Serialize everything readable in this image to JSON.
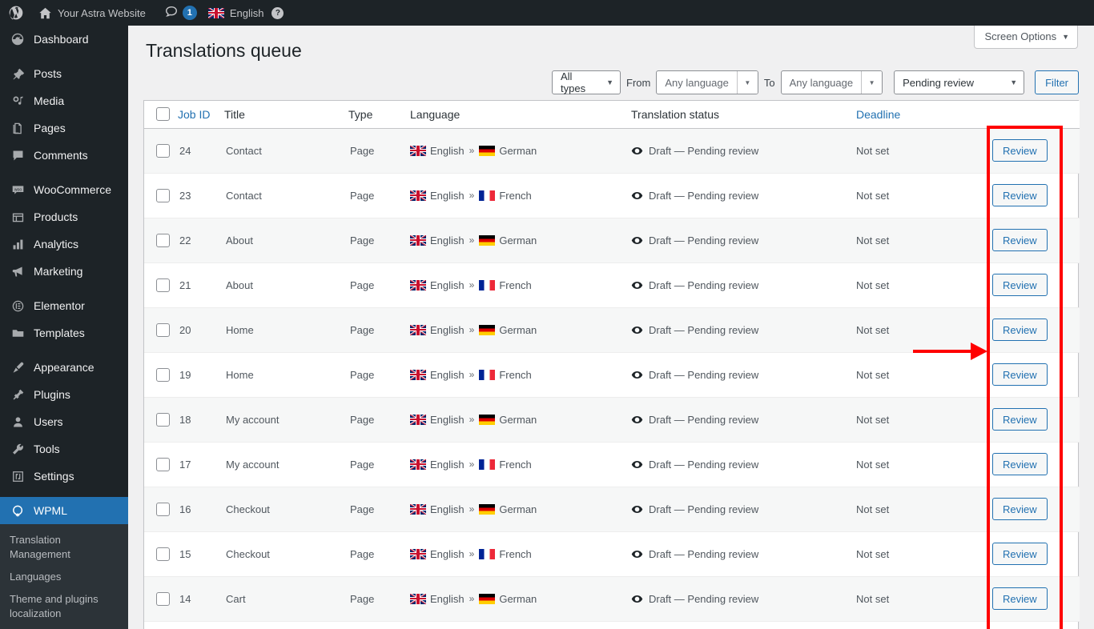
{
  "adminbar": {
    "wp_logo": "wordpress-logo-icon",
    "home_icon": "home-icon",
    "site_name": "Your Astra Website",
    "comment_icon": "comment-bubble-icon",
    "comment_count": "1",
    "flag_icon": "uk-flag-icon",
    "language": "English",
    "help_icon": "?"
  },
  "sidebar": {
    "items": [
      {
        "label": "Dashboard",
        "icon": "dashboard-icon"
      },
      {
        "label": "Posts",
        "icon": "pin-icon"
      },
      {
        "label": "Media",
        "icon": "media-icon"
      },
      {
        "label": "Pages",
        "icon": "pages-icon"
      },
      {
        "label": "Comments",
        "icon": "comments-icon"
      },
      {
        "label": "WooCommerce",
        "icon": "woocommerce-icon"
      },
      {
        "label": "Products",
        "icon": "products-icon"
      },
      {
        "label": "Analytics",
        "icon": "analytics-icon"
      },
      {
        "label": "Marketing",
        "icon": "megaphone-icon"
      },
      {
        "label": "Elementor",
        "icon": "elementor-icon"
      },
      {
        "label": "Templates",
        "icon": "folder-icon"
      },
      {
        "label": "Appearance",
        "icon": "paintbrush-icon"
      },
      {
        "label": "Plugins",
        "icon": "plug-icon"
      },
      {
        "label": "Users",
        "icon": "user-icon"
      },
      {
        "label": "Tools",
        "icon": "wrench-icon"
      },
      {
        "label": "Settings",
        "icon": "settings-icon"
      },
      {
        "label": "WPML",
        "icon": "wpml-icon"
      }
    ],
    "submenu": [
      "Translation Management",
      "Languages",
      "Theme and plugins localization"
    ]
  },
  "header": {
    "screen_options": "Screen Options",
    "screen_options_caret": "▼",
    "page_title": "Translations queue"
  },
  "filters": {
    "type": "All types",
    "from_label": "From",
    "from_value": "Any language",
    "to_label": "To",
    "to_value": "Any language",
    "status": "Pending review",
    "filter_button": "Filter",
    "caret": "▼"
  },
  "table": {
    "columns": {
      "job_id": "Job ID",
      "title": "Title",
      "type": "Type",
      "language": "Language",
      "status": "Translation status",
      "deadline": "Deadline"
    },
    "rows": [
      {
        "job_id": "24",
        "title": "Contact",
        "type": "Page",
        "src": "English",
        "dst": "German",
        "dst_flag": "de",
        "status": "Draft — Pending review",
        "deadline": "Not set",
        "action": "Review"
      },
      {
        "job_id": "23",
        "title": "Contact",
        "type": "Page",
        "src": "English",
        "dst": "French",
        "dst_flag": "fr",
        "status": "Draft — Pending review",
        "deadline": "Not set",
        "action": "Review"
      },
      {
        "job_id": "22",
        "title": "About",
        "type": "Page",
        "src": "English",
        "dst": "German",
        "dst_flag": "de",
        "status": "Draft — Pending review",
        "deadline": "Not set",
        "action": "Review"
      },
      {
        "job_id": "21",
        "title": "About",
        "type": "Page",
        "src": "English",
        "dst": "French",
        "dst_flag": "fr",
        "status": "Draft — Pending review",
        "deadline": "Not set",
        "action": "Review"
      },
      {
        "job_id": "20",
        "title": "Home",
        "type": "Page",
        "src": "English",
        "dst": "German",
        "dst_flag": "de",
        "status": "Draft — Pending review",
        "deadline": "Not set",
        "action": "Review"
      },
      {
        "job_id": "19",
        "title": "Home",
        "type": "Page",
        "src": "English",
        "dst": "French",
        "dst_flag": "fr",
        "status": "Draft — Pending review",
        "deadline": "Not set",
        "action": "Review"
      },
      {
        "job_id": "18",
        "title": "My account",
        "type": "Page",
        "src": "English",
        "dst": "German",
        "dst_flag": "de",
        "status": "Draft — Pending review",
        "deadline": "Not set",
        "action": "Review"
      },
      {
        "job_id": "17",
        "title": "My account",
        "type": "Page",
        "src": "English",
        "dst": "French",
        "dst_flag": "fr",
        "status": "Draft — Pending review",
        "deadline": "Not set",
        "action": "Review"
      },
      {
        "job_id": "16",
        "title": "Checkout",
        "type": "Page",
        "src": "English",
        "dst": "German",
        "dst_flag": "de",
        "status": "Draft — Pending review",
        "deadline": "Not set",
        "action": "Review"
      },
      {
        "job_id": "15",
        "title": "Checkout",
        "type": "Page",
        "src": "English",
        "dst": "French",
        "dst_flag": "fr",
        "status": "Draft — Pending review",
        "deadline": "Not set",
        "action": "Review"
      },
      {
        "job_id": "14",
        "title": "Cart",
        "type": "Page",
        "src": "English",
        "dst": "German",
        "dst_flag": "de",
        "status": "Draft — Pending review",
        "deadline": "Not set",
        "action": "Review"
      }
    ],
    "lang_separator": "»"
  },
  "annotations": {
    "highlight_box": "red-rectangle-around-review-buttons",
    "arrow": "red-arrow-pointing-right"
  },
  "colors": {
    "accent": "#2271b1",
    "admin_bg": "#1d2327",
    "submenu_bg": "#2c3338",
    "annotation": "#ff0000",
    "row_alt": "#f6f7f7"
  }
}
